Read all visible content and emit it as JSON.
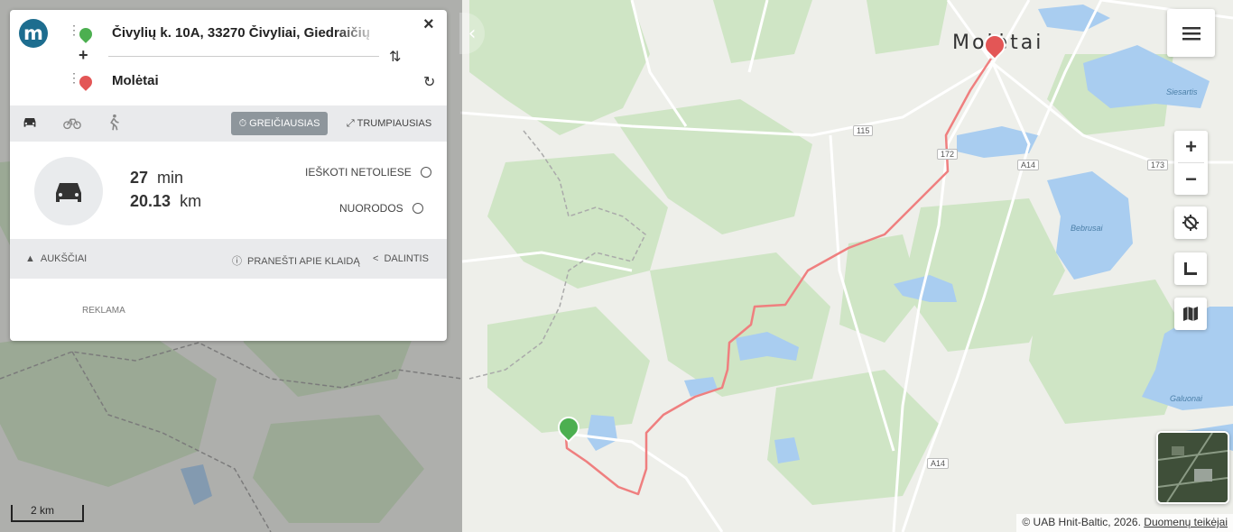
{
  "route_panel": {
    "logo": "m",
    "from": "Čivylių k. 10A, 33270 Čivyliai, Giedraičių",
    "to": "Molėtai",
    "close_icon": "×",
    "add_icon": "+",
    "swap_icon": "⇅",
    "reverse_icon": "↻"
  },
  "modes": {
    "car": "car-icon",
    "bike": "bike-icon",
    "walk": "walk-icon",
    "fastest": "GREIČIAUSIAS",
    "shortest": "TRUMPIAUSIAS",
    "fastest_icon": "⏱",
    "shortest_icon": "⤢"
  },
  "summary": {
    "time_value": "27",
    "time_unit": "min",
    "distance_value": "20.13",
    "distance_unit": "km",
    "search_nearby": "IEŠKOTI NETOLIESE",
    "directions": "NUORODOS"
  },
  "footer": {
    "elevation": "AUKŠČIAI",
    "report": "PRANEŠTI APIE KLAIDĄ",
    "share": "DALINTIS",
    "ad": "REKLAMA"
  },
  "map": {
    "place_moletai": "Molėtai",
    "roads": [
      "115",
      "172",
      "A14",
      "173",
      "A14"
    ],
    "lakes": [
      "Siesartis",
      "Bebrusai",
      "Galuonai"
    ],
    "scale": "2 km",
    "attribution_text": "© UAB Hnit-Baltic, 2026.",
    "attribution_link": "Duomenų teikėjai",
    "colors": {
      "route": "#ef7f7f",
      "water": "#a9cdf0",
      "forest": "#cde5c4",
      "origin_marker": "#4caf50",
      "destination_marker": "#e35656"
    }
  },
  "controls": {
    "menu_icon": "menu-icon",
    "zoom_in": "+",
    "zoom_out": "−"
  }
}
